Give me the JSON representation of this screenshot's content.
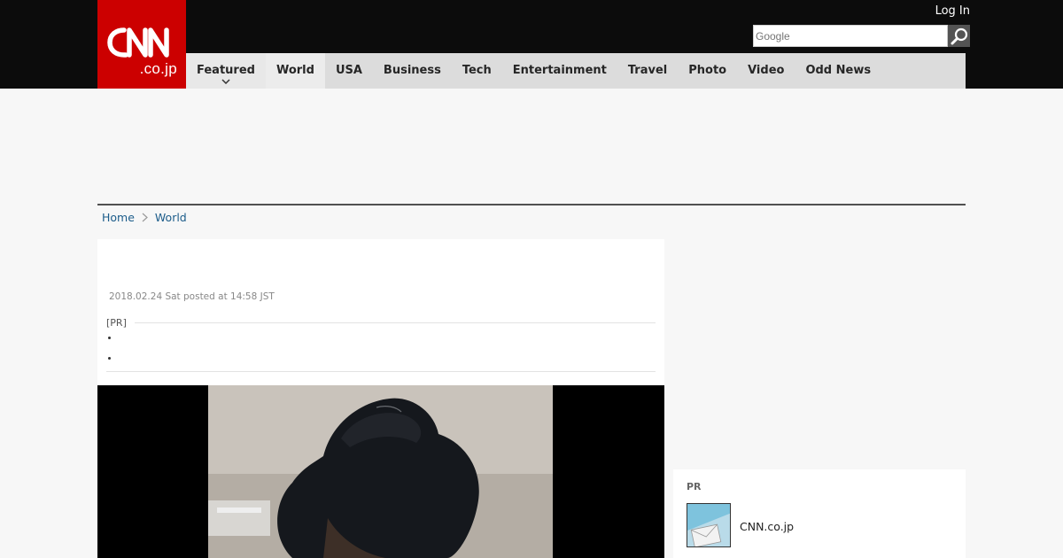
{
  "header": {
    "logo_text": "CNN",
    "logo_sub": ".co.jp",
    "login_label": "Log In",
    "search_placeholder": "Google",
    "colors": {
      "topbar": "#0c0c0c",
      "brand_red": "#cc0000",
      "nav_bg": "#dcdcdc"
    }
  },
  "nav": {
    "items": [
      {
        "label": "Featured"
      },
      {
        "label": "World"
      },
      {
        "label": "USA"
      },
      {
        "label": "Business"
      },
      {
        "label": "Tech"
      },
      {
        "label": "Entertainment"
      },
      {
        "label": "Travel"
      },
      {
        "label": "Photo"
      },
      {
        "label": "Video"
      },
      {
        "label": "Odd News"
      }
    ],
    "active": "World"
  },
  "breadcrumb": {
    "home": "Home",
    "current": "World"
  },
  "article": {
    "date": "2018.02.24 Sat posted at 14:58 JST",
    "pr_label": "[PR]"
  },
  "sidebar": {
    "pr_label": "PR",
    "pr_item_title": "CNN.co.jp"
  }
}
